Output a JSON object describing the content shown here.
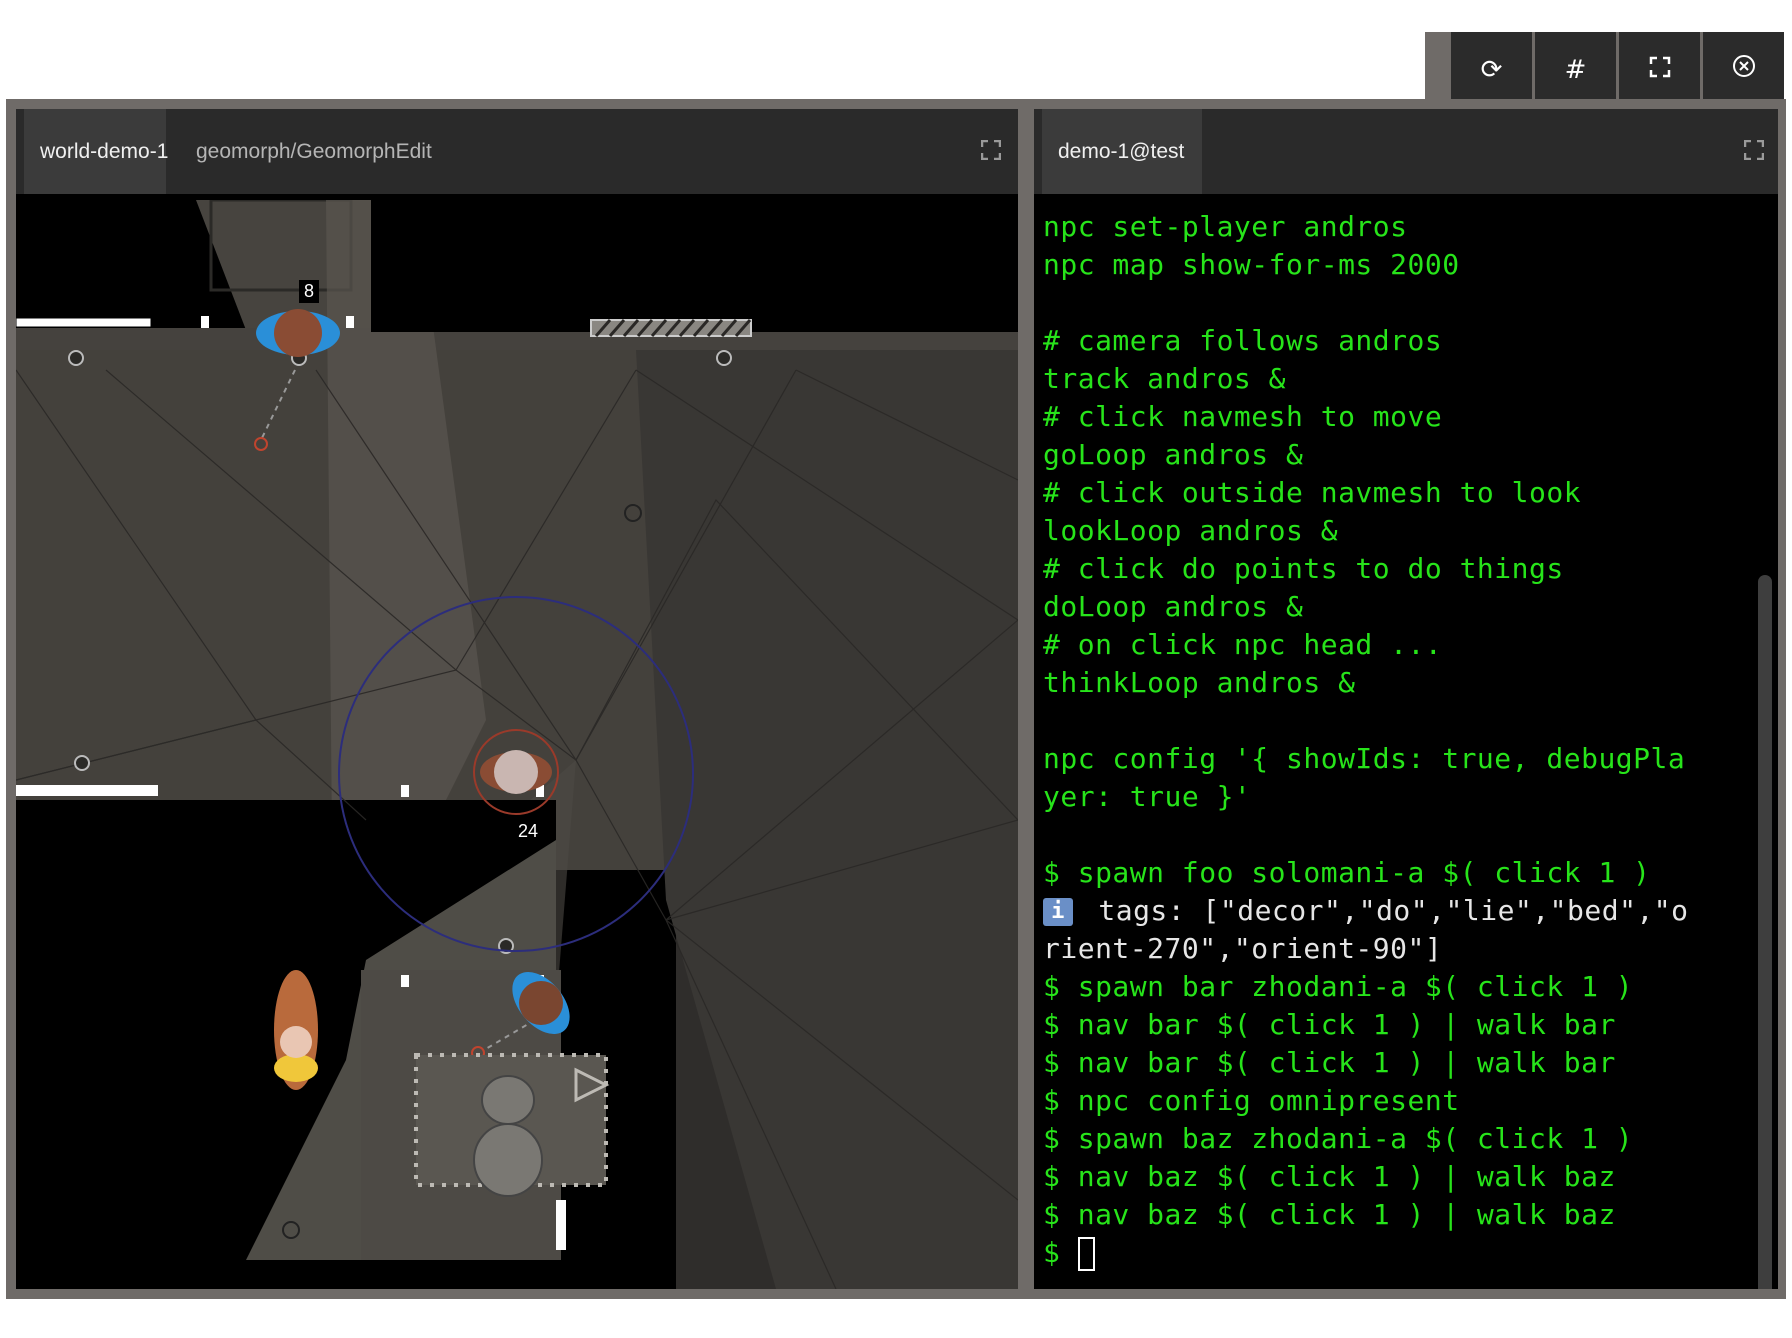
{
  "toolbar": {
    "buttons": [
      {
        "icon": "refresh-icon",
        "glyph": "⟳"
      },
      {
        "icon": "hash-icon",
        "glyph": "#"
      },
      {
        "icon": "fullscreen-icon",
        "glyph": "⛶"
      },
      {
        "icon": "close-circle-icon",
        "glyph": "⊗"
      }
    ]
  },
  "left_pane": {
    "tabs": [
      {
        "label": "world-demo-1",
        "active": true
      },
      {
        "label": "geomorph/GeomorphEdit",
        "active": false
      }
    ],
    "npc_labels": [
      "8",
      "24"
    ]
  },
  "right_pane": {
    "tabs": [
      {
        "label": "demo-1@test",
        "active": true
      }
    ],
    "terminal": {
      "lines": [
        "npc set-player andros",
        "npc map show-for-ms 2000",
        "",
        "# camera follows andros",
        "track andros &",
        "# click navmesh to move",
        "goLoop andros &",
        "# click outside navmesh to look",
        "lookLoop andros &",
        "# click do points to do things",
        "doLoop andros &",
        "# on click npc head ...",
        "thinkLoop andros &",
        "",
        "npc config '{ showIds: true, debugPla",
        "yer: true }'",
        "",
        "$ spawn foo solomani-a $( click 1 )",
        " tags: [\"decor\",\"do\",\"lie\",\"bed\",\"o",
        "rient-270\",\"orient-90\"]",
        "$ spawn bar zhodani-a $( click 1 )",
        "$ nav bar $( click 1 ) | walk bar",
        "$ nav bar $( click 1 ) | walk bar",
        "$ npc config omnipresent",
        "$ spawn baz zhodani-a $( click 1 )",
        "$ nav baz $( click 1 ) | walk baz",
        "$ nav baz $( click 1 ) | walk baz",
        "$ "
      ],
      "info_icon_text": "i"
    }
  },
  "colors": {
    "terminal_green": "#27e41a",
    "frame": "#6f6b68",
    "tabbar": "#2a2a2a"
  }
}
